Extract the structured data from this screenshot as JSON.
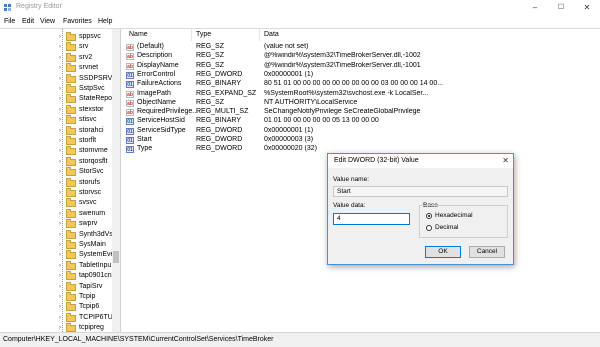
{
  "window": {
    "title": "Registry Editor",
    "controls": {
      "minimize": "–",
      "maximize": "☐",
      "close": "✕"
    }
  },
  "menu": [
    "File",
    "Edit",
    "View",
    "Favorites",
    "Help"
  ],
  "tree": {
    "items": [
      "sppsvc",
      "srv",
      "srv2",
      "srvnet",
      "SSDPSRV",
      "SstpSvc",
      "StateRepos",
      "stexstor",
      "stisvc",
      "storahci",
      "storflt",
      "stornvme",
      "storqosflt",
      "StorSvc",
      "storufs",
      "storvsc",
      "svsvc",
      "swenum",
      "swprv",
      "Synth3dVs",
      "SysMain",
      "SystemEve",
      "TabletInpu",
      "tap0901cn",
      "TapiSrv",
      "Tcpip",
      "Tcpip6",
      "TCPIP6TUN",
      "tcpipreg"
    ]
  },
  "list": {
    "headers": {
      "name": "Name",
      "type": "Type",
      "data": "Data"
    },
    "rows": [
      {
        "icon": "sz",
        "name": "(Default)",
        "type": "REG_SZ",
        "data": "(value not set)"
      },
      {
        "icon": "sz",
        "name": "Description",
        "type": "REG_SZ",
        "data": "@%windir%\\system32\\TimeBrokerServer.dll,-1002"
      },
      {
        "icon": "sz",
        "name": "DisplayName",
        "type": "REG_SZ",
        "data": "@%windir%\\system32\\TimeBrokerServer.dll,-1001"
      },
      {
        "icon": "bin",
        "name": "ErrorControl",
        "type": "REG_DWORD",
        "data": "0x00000001 (1)"
      },
      {
        "icon": "bin",
        "name": "FailureActions",
        "type": "REG_BINARY",
        "data": "80 51 01 00 00 00 00 00 00 00 00 00 03 00 00 00 14 00..."
      },
      {
        "icon": "sz",
        "name": "ImagePath",
        "type": "REG_EXPAND_SZ",
        "data": "%SystemRoot%\\system32\\svchost.exe -k LocalSer..."
      },
      {
        "icon": "sz",
        "name": "ObjectName",
        "type": "REG_SZ",
        "data": "NT AUTHORITY\\LocalService"
      },
      {
        "icon": "sz",
        "name": "RequiredPrivilege...",
        "type": "REG_MULTI_SZ",
        "data": "SeChangeNotifyPrivilege SeCreateGlobalPrivilege"
      },
      {
        "icon": "bin",
        "name": "ServiceHostSid",
        "type": "REG_BINARY",
        "data": "01 01 00 00 00 00 00 05 13 00 00 00"
      },
      {
        "icon": "bin",
        "name": "ServiceSidType",
        "type": "REG_DWORD",
        "data": "0x00000001 (1)"
      },
      {
        "icon": "bin",
        "name": "Start",
        "type": "REG_DWORD",
        "data": "0x00000003 (3)"
      },
      {
        "icon": "bin",
        "name": "Type",
        "type": "REG_DWORD",
        "data": "0x00000020 (32)"
      }
    ]
  },
  "statusbar": {
    "path": "Computer\\HKEY_LOCAL_MACHINE\\SYSTEM\\CurrentControlSet\\Services\\TimeBroker"
  },
  "dialog": {
    "title": "Edit DWORD (32-bit) Value",
    "close": "✕",
    "value_name_label": "Value name:",
    "value_name": "Start",
    "value_data_label": "Value data:",
    "value_data": "4",
    "base_label": "Base",
    "hex_label": "Hexadecimal",
    "dec_label": "Decimal",
    "selected_base": "Hexadecimal",
    "ok_label": "OK",
    "cancel_label": "Cancel"
  }
}
